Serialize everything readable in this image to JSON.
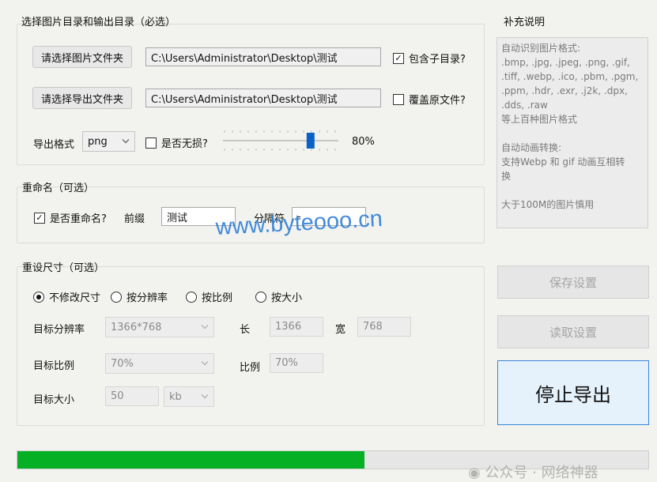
{
  "groups": {
    "dirs_title": "选择图片目录和输出目录（必选）",
    "rename_title": "重命名（可选）",
    "resize_title": "重设尺寸（可选）",
    "notes_title": "补充说明"
  },
  "dirs": {
    "choose_image_btn": "请选择图片文件夹",
    "image_path": "C:\\Users\\Administrator\\Desktop\\测试",
    "include_subdirs_label": "包含子目录?",
    "include_subdirs_checked": true,
    "choose_export_btn": "请选择导出文件夹",
    "export_path": "C:\\Users\\Administrator\\Desktop\\测试",
    "overwrite_label": "覆盖原文件?",
    "overwrite_checked": false
  },
  "format": {
    "label": "导出格式",
    "value": "png",
    "lossless_label": "是否无损?",
    "lossless_checked": false,
    "quality_value": 80,
    "quality_text": "80%"
  },
  "rename": {
    "enable_label": "是否重命名?",
    "enable_checked": true,
    "prefix_label": "前缀",
    "prefix_value": "测试",
    "separator_label": "分隔符",
    "separator_value": "-"
  },
  "watermark": "www.byteooo.cn",
  "resize": {
    "options": [
      "不修改尺寸",
      "按分辨率",
      "按比例",
      "按大小"
    ],
    "selected_index": 0,
    "resolution_label": "目标分辨率",
    "resolution_value": "1366*768",
    "length_label": "长",
    "length_value": "1366",
    "width_label": "宽",
    "width_value": "768",
    "ratio_label": "目标比例",
    "ratio_value": "70%",
    "ratio_field_label": "比例",
    "ratio_field_value": "70%",
    "size_label": "目标大小",
    "size_value": "50",
    "size_unit": "kb"
  },
  "notes": {
    "text": "自动识别图片格式:\n.bmp, .jpg, .jpeg, .png, .gif,\n.tiff, .webp, .ico, .pbm, .pgm,\n.ppm, .hdr, .exr, .j2k, .dpx,\n.dds, .raw\n等上百种图片格式\n\n自动动画转换:\n支持Webp 和 gif 动画互相转\n换\n\n大于100M的图片慎用"
  },
  "side_buttons": {
    "save": "保存设置",
    "load": "读取设置",
    "stop": "停止导出"
  },
  "progress": {
    "value": 0.55,
    "color": "#06b025"
  },
  "footer_watermark": "公众号 · 网络神器"
}
